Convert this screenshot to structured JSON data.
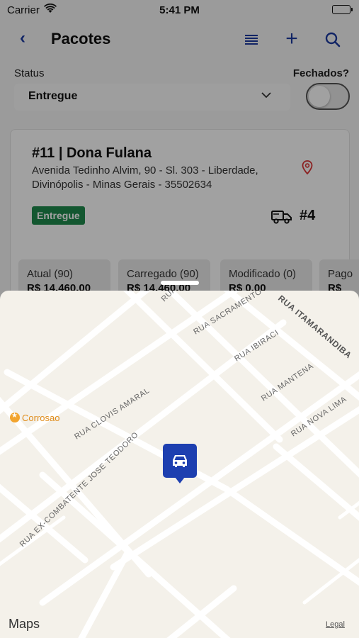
{
  "status_bar": {
    "carrier": "Carrier",
    "time": "5:41 PM"
  },
  "nav": {
    "back": "‹",
    "title": "Pacotes",
    "add": "+"
  },
  "filters": {
    "status_label": "Status",
    "status_value": "Entregue",
    "closed_label": "Fechados?",
    "closed_toggle_on": false
  },
  "package": {
    "title": "#11 | Dona Fulana",
    "address_line1": "Avenida Tedinho Alvim, 90 - Sl. 303 - Liberdade,",
    "address_line2": "Divinópolis - Minas Gerais - 35502634",
    "status_badge": "Entregue",
    "status_color": "#1f8a4c",
    "route_number": "#4"
  },
  "stats": [
    {
      "label": "Atual (90)",
      "value": "R$ 14.460,00"
    },
    {
      "label": "Carregado (90)",
      "value": "R$ 14.460,00"
    },
    {
      "label": "Modificado (0)",
      "value": "R$ 0,00"
    },
    {
      "label": "Pago",
      "value": "R$"
    }
  ],
  "map": {
    "streets": [
      "RUA SACRAMENTO",
      "RUA ITAMARANDIBA",
      "RUA IBIRACI",
      "RUA MANTENA",
      "RUA NOVA LIMA",
      "RUA CLOVIS AMARAL",
      "RUA EX-COMBATENTE JOSE TEODORO",
      "RUA"
    ],
    "poi": "Corrosao",
    "marker_icon": "car-icon",
    "marker_color": "#1d3fb0",
    "attribution": "Maps",
    "legal": "Legal"
  },
  "accent_color": "#1c3aa0"
}
